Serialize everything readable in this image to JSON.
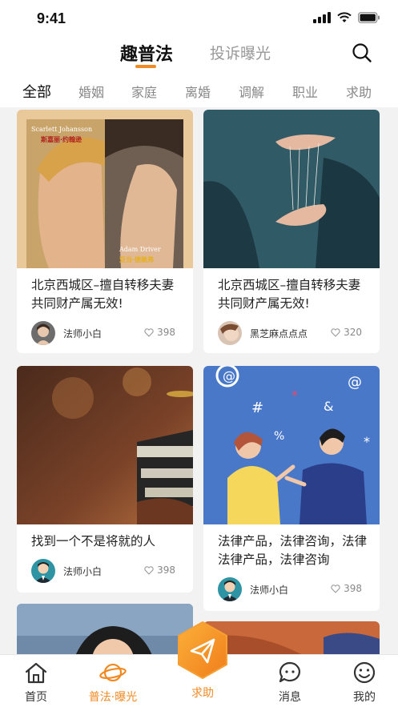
{
  "status": {
    "time": "9:41"
  },
  "topnav": {
    "tabs": [
      {
        "label": "趣普法"
      },
      {
        "label": "投诉曝光"
      }
    ]
  },
  "categories": [
    "全部",
    "婚姻",
    "家庭",
    "离婚",
    "调解",
    "职业",
    "求助"
  ],
  "poster": {
    "name_top_en": "Scarlett Johansson",
    "name_top_cn": "斯嘉丽·约翰逊",
    "name_bottom_en": "Adam Driver",
    "name_bottom_cn": "亚当·德赖弗"
  },
  "cards": [
    {
      "title": "北京西城区–擅自转移夫妻共同财产属无效!",
      "author": "法师小白",
      "likes": "398"
    },
    {
      "title": "北京西城区–擅自转移夫妻共同财产属无效!",
      "author": "黑芝麻点点点",
      "likes": "320"
    },
    {
      "title": "找到一个不是将就的人",
      "author": "法师小白",
      "likes": "398"
    },
    {
      "title": "法律产品，法律咨询，法律法律产品，法律咨询",
      "author": "法师小白",
      "likes": "398"
    }
  ],
  "bottomnav": {
    "items": [
      {
        "label": "首页"
      },
      {
        "label": "普法·曝光"
      },
      {
        "label": "求助"
      },
      {
        "label": "消息"
      },
      {
        "label": "我的"
      }
    ]
  },
  "colors": {
    "accent": "#f08a24",
    "background": "#f2f2f2"
  },
  "icons": [
    "search-icon",
    "signal-icon",
    "wifi-icon",
    "battery-icon",
    "heart-icon",
    "home-icon",
    "planet-icon",
    "send-icon",
    "message-icon",
    "smile-icon"
  ]
}
